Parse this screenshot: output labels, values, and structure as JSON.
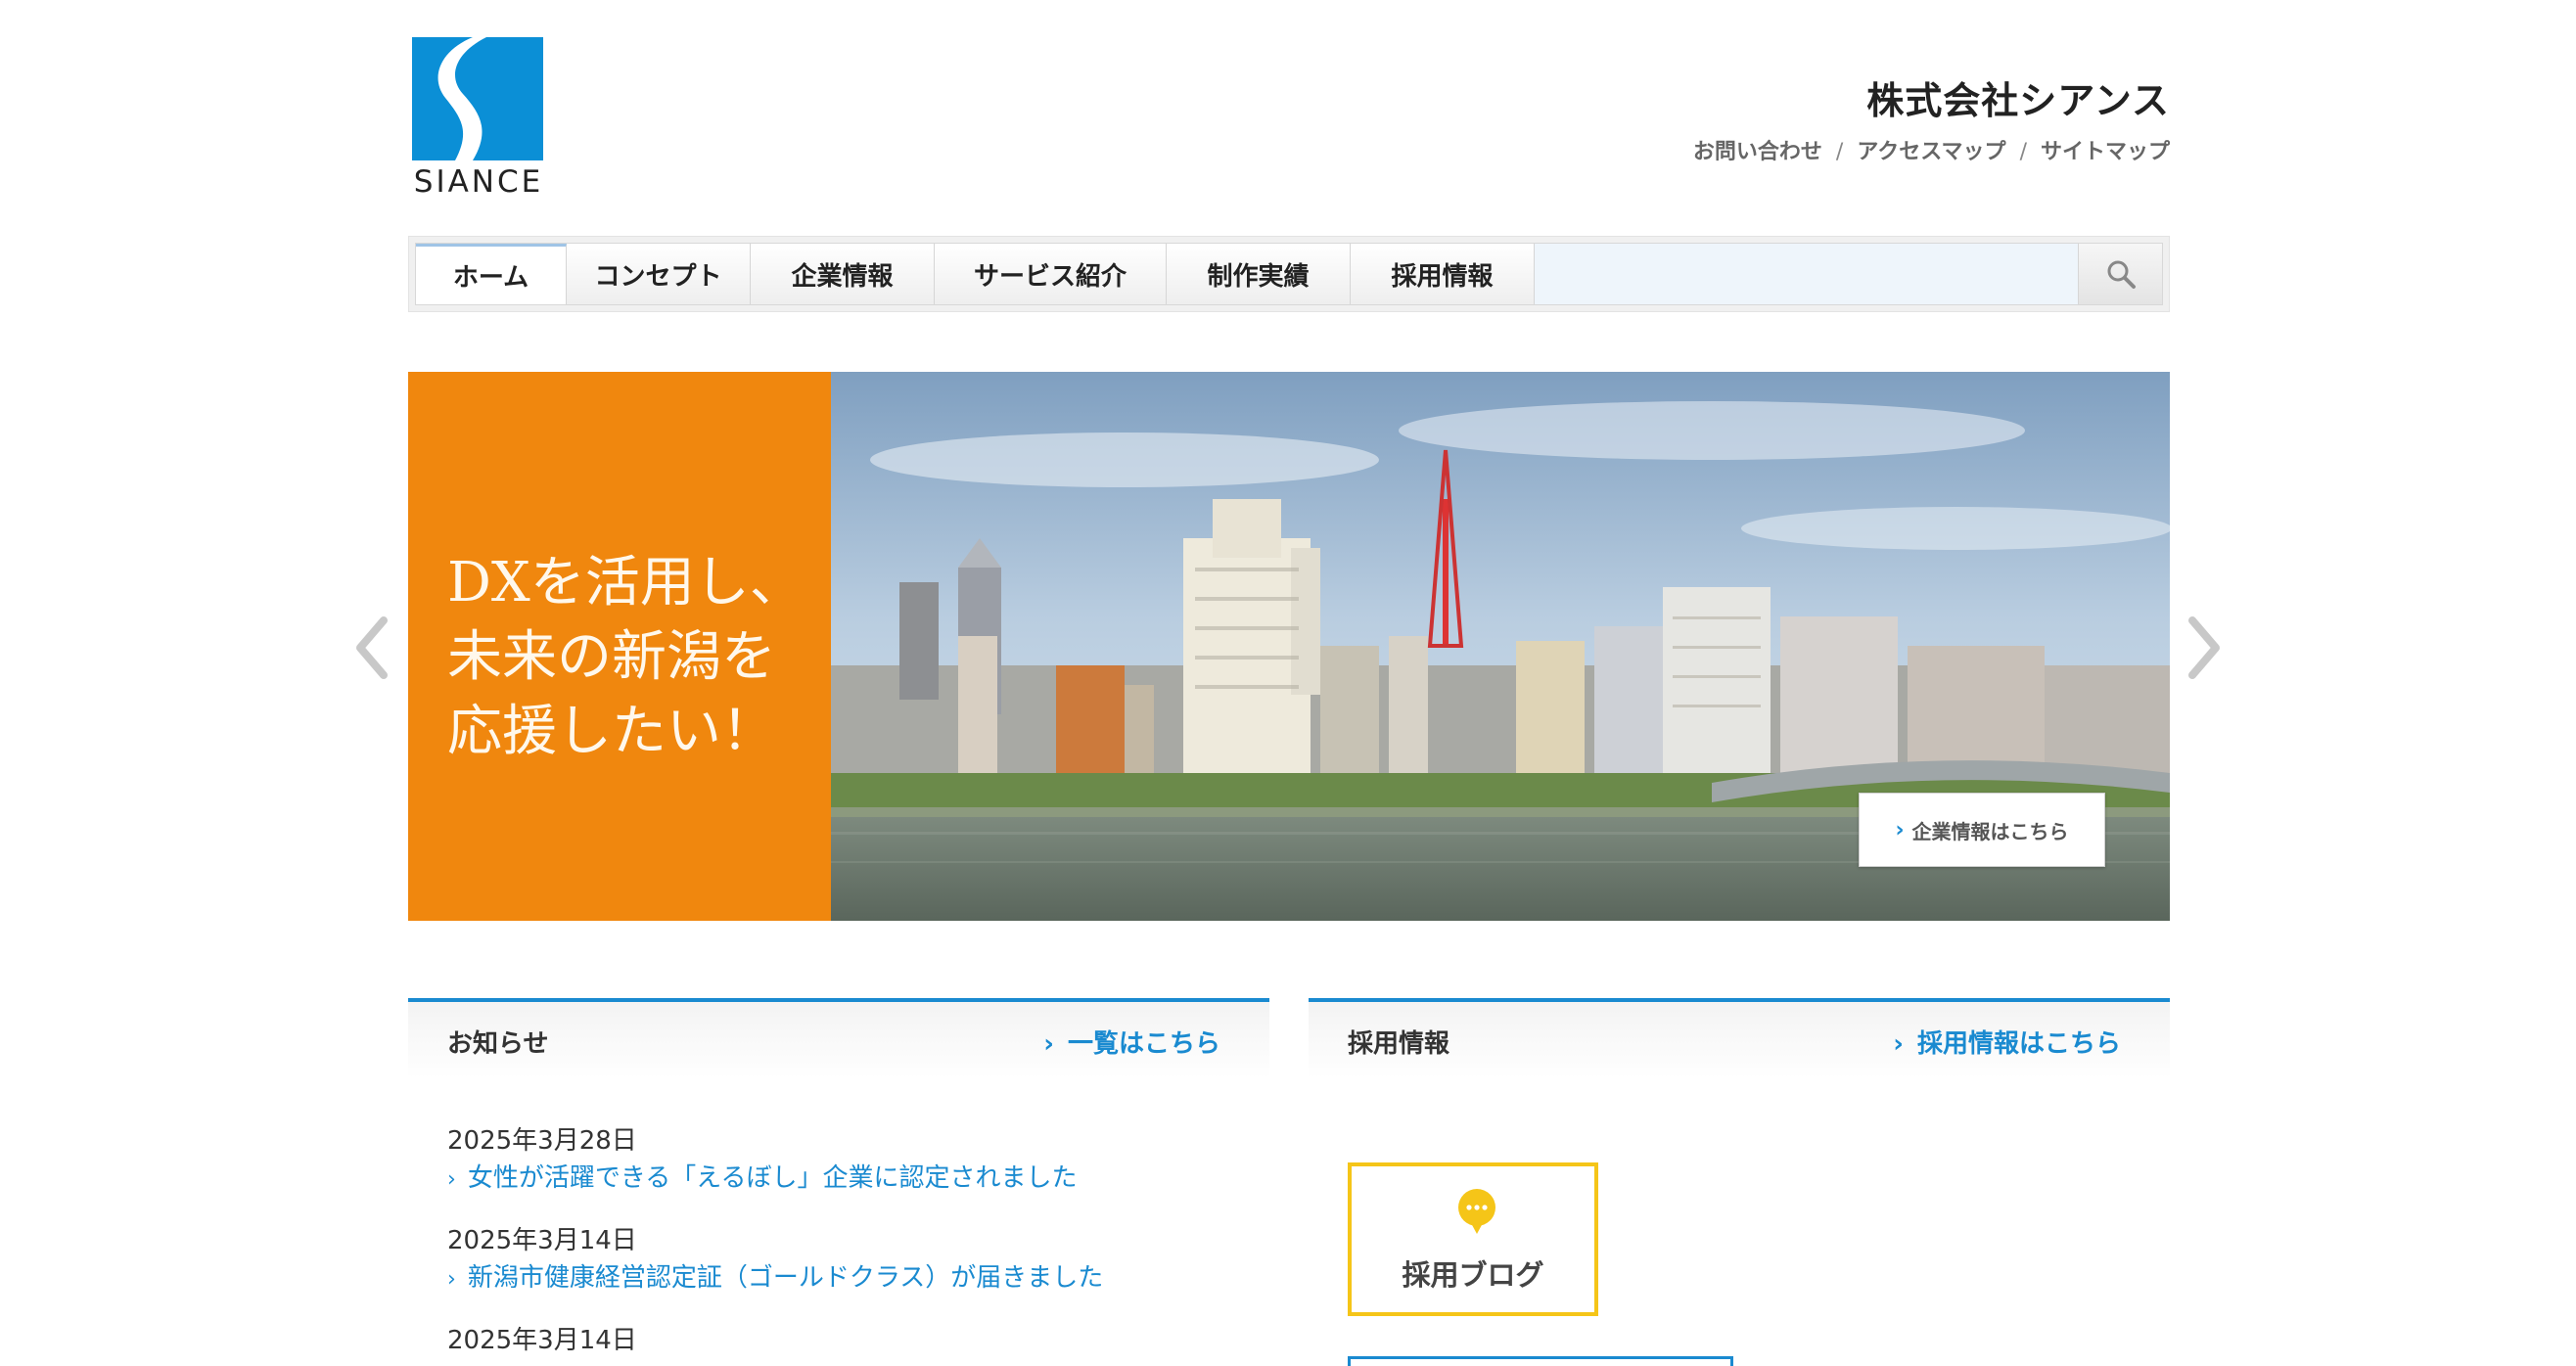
{
  "header": {
    "logo_text": "SIANCE",
    "company_name": "株式会社シアンス",
    "utility_links": [
      "お問い合わせ",
      "アクセスマップ",
      "サイトマップ"
    ],
    "utility_separator": "/"
  },
  "nav": {
    "tabs": [
      {
        "label": "ホーム",
        "active": true
      },
      {
        "label": "コンセプト",
        "active": false
      },
      {
        "label": "企業情報",
        "active": false
      },
      {
        "label": "サービス紹介",
        "active": false
      },
      {
        "label": "制作実績",
        "active": false
      },
      {
        "label": "採用情報",
        "active": false
      }
    ],
    "search_placeholder": ""
  },
  "hero": {
    "headline_lines": [
      "DXを活用し、",
      "未来の新潟を",
      "応援したい！"
    ],
    "cta_label": "企業情報はこちら"
  },
  "news": {
    "title": "お知らせ",
    "more_label": "一覧はこちら",
    "items": [
      {
        "date": "2025年3月28日",
        "title": "女性が活躍できる「えるぼし」企業に認定されました"
      },
      {
        "date": "2025年3月14日",
        "title": "新潟市健康経営認定証（ゴールドクラス）が届きました"
      },
      {
        "date": "2025年3月14日",
        "title": ""
      }
    ]
  },
  "recruit": {
    "title": "採用情報",
    "more_label": "採用情報はこちら",
    "blog_label": "採用ブログ"
  },
  "colors": {
    "brand_blue": "#1a8ad0",
    "hero_orange": "#f0870e",
    "blog_border": "#f5c518"
  },
  "icons": {
    "search": "search-icon",
    "prev": "chevron-left-icon",
    "next": "chevron-right-icon",
    "blog": "speech-bubble-icon"
  }
}
